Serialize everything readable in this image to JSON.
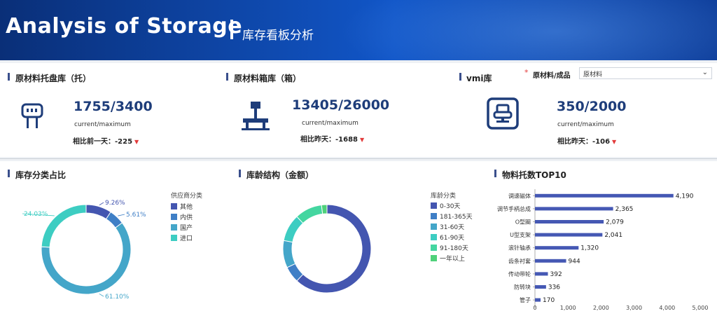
{
  "header": {
    "title": "Analysis of Storage",
    "subtitle": "库存看板分析"
  },
  "stats": [
    {
      "title": "原材料托盘库（托）",
      "value": "1755/3400",
      "caption": "current/maximum",
      "compare": "相比前一天：-225"
    },
    {
      "title": "原材料箱库（箱）",
      "value": "13405/26000",
      "caption": "current/maximum",
      "compare": "相比昨天：-1688"
    },
    {
      "title": "vmi库",
      "value": "350/2000",
      "caption": "current/maximum",
      "compare": "相比昨天：-106"
    }
  ],
  "filter": {
    "required_mark": "*",
    "label": "原材料/成品",
    "selected": "原材料"
  },
  "colors": {
    "accent": "#3a4f8c",
    "down": "#e23a3a",
    "bar": "#4558b4"
  },
  "chart_data": [
    {
      "type": "pie",
      "title": "库存分类占比",
      "legend_title": "供应商分类",
      "categories": [
        "其他",
        "内供",
        "国产",
        "进口"
      ],
      "values": [
        9.26,
        5.61,
        61.1,
        24.03
      ],
      "labels": [
        "9.26%",
        "5.61%",
        "61.10%",
        "24.03%"
      ],
      "colors": [
        "#4456b0",
        "#3f7fc6",
        "#44a6c9",
        "#3dcdc2"
      ],
      "legend": "right"
    },
    {
      "type": "pie",
      "title": "库龄结构（金额）",
      "legend_title": "库龄分类",
      "categories": [
        "0-30天",
        "181-365天",
        "31-60天",
        "61-90天",
        "91-180天",
        "一年以上"
      ],
      "values": [
        62,
        6,
        10,
        10,
        10,
        2
      ],
      "colors": [
        "#4456b0",
        "#3f7fc6",
        "#44a6c9",
        "#3dcdc2",
        "#44d6a0",
        "#4fd17a"
      ],
      "legend": "right"
    },
    {
      "type": "bar",
      "orientation": "horizontal",
      "title": "物料托数TOP10",
      "categories": [
        "调速磁体",
        "调节手柄总成",
        "O型圈",
        "U型支架",
        "滚针轴承",
        "齿条衬套",
        "传动带轮",
        "防转块",
        "管子"
      ],
      "values": [
        4190,
        2365,
        2079,
        2041,
        1320,
        944,
        392,
        336,
        170
      ],
      "value_labels": [
        "4,190",
        "2,365",
        "2,079",
        "2,041",
        "1,320",
        "944",
        "392",
        "336",
        "170"
      ],
      "x_ticks": [
        "0",
        "1,000",
        "2,000",
        "3,000",
        "4,000",
        "5,000"
      ],
      "xlim": [
        0,
        5000
      ]
    }
  ]
}
